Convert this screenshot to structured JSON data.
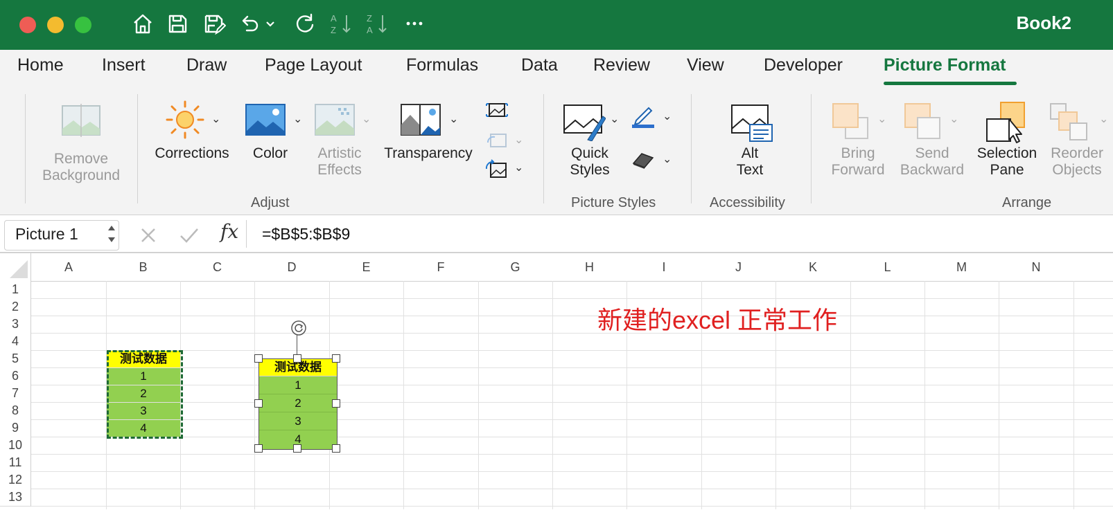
{
  "window": {
    "title": "Book2",
    "traffic_colors": [
      "#ee5d55",
      "#f4bb2f",
      "#37c140"
    ]
  },
  "toolbar_icons": [
    "home-icon",
    "save-icon",
    "save-as-icon",
    "undo-icon",
    "chevron-down-icon",
    "redo-icon",
    "sort-ascending-icon",
    "sort-descending-icon",
    "more-icon"
  ],
  "tabs": [
    {
      "label": "Home"
    },
    {
      "label": "Insert"
    },
    {
      "label": "Draw"
    },
    {
      "label": "Page Layout"
    },
    {
      "label": "Formulas"
    },
    {
      "label": "Data"
    },
    {
      "label": "Review"
    },
    {
      "label": "View"
    },
    {
      "label": "Developer"
    },
    {
      "label": "Picture Format",
      "active": true
    }
  ],
  "ribbon": {
    "remove_background": {
      "line1": "Remove",
      "line2": "Background"
    },
    "corrections": "Corrections",
    "color": "Color",
    "artistic_effects": {
      "line1": "Artistic",
      "line2": "Effects"
    },
    "transparency": "Transparency",
    "adjust_group": "Adjust",
    "quick_styles": {
      "line1": "Quick",
      "line2": "Styles"
    },
    "picture_styles_group": "Picture Styles",
    "alt_text": {
      "line1": "Alt",
      "line2": "Text"
    },
    "accessibility_group": "Accessibility",
    "bring_forward": {
      "line1": "Bring",
      "line2": "Forward"
    },
    "send_backward": {
      "line1": "Send",
      "line2": "Backward"
    },
    "selection_pane": {
      "line1": "Selection",
      "line2": "Pane"
    },
    "reorder_objects": {
      "line1": "Reorder",
      "line2": "Objects"
    },
    "arrange_group": "Arrange"
  },
  "formula_bar": {
    "name_box": "Picture 1",
    "cancel_icon": "close-icon",
    "enter_icon": "check-icon",
    "fx_label": "fx",
    "formula": "=$B$5:$B$9"
  },
  "sheet": {
    "columns": [
      "A",
      "B",
      "C",
      "D",
      "E",
      "F",
      "G",
      "H",
      "I",
      "J",
      "K",
      "L",
      "M",
      "N"
    ],
    "rows": [
      "1",
      "2",
      "3",
      "4",
      "5",
      "6",
      "7",
      "8",
      "9",
      "10",
      "11",
      "12",
      "13"
    ],
    "range_header": "测试数据",
    "range_values": [
      "1",
      "2",
      "3",
      "4"
    ],
    "picture_header": "测试数据",
    "picture_values": [
      "1",
      "2",
      "3",
      "4"
    ],
    "note": "新建的excel 正常工作",
    "header_fill": "#ffff00",
    "data_fill": "#92d050",
    "note_color": "#e02020"
  }
}
